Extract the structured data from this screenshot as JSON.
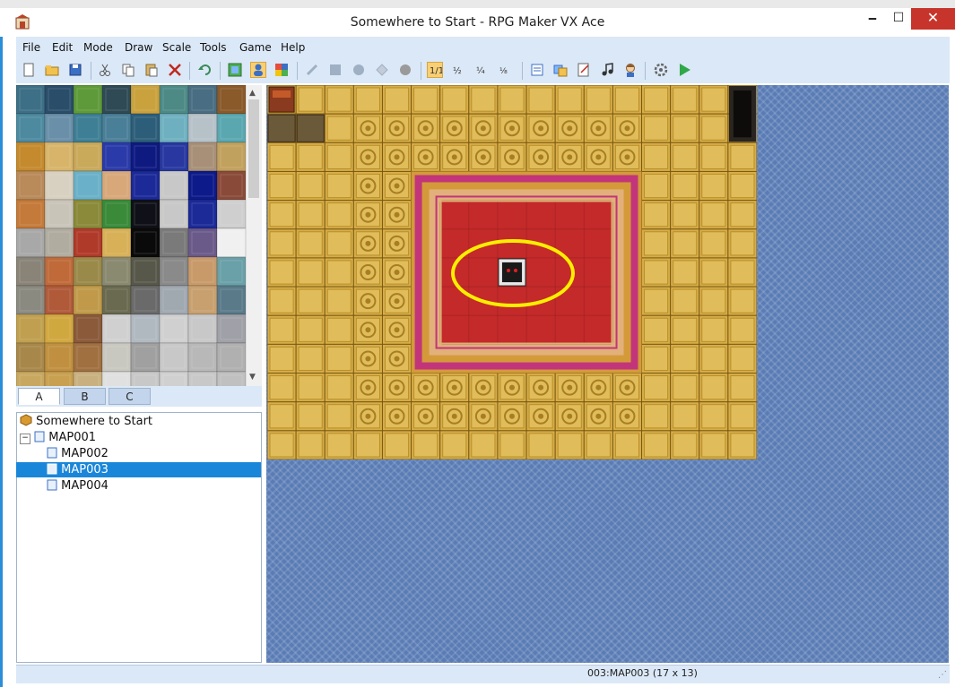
{
  "window": {
    "title": "Somewhere to Start - RPG Maker VX Ace",
    "controls": {
      "minimize": "🗕",
      "maximize": "☐",
      "close": "✕"
    }
  },
  "menu": [
    "File",
    "Edit",
    "Mode",
    "Draw",
    "Scale",
    "Tools",
    "Game",
    "Help"
  ],
  "toolbar": {
    "icons": [
      "new-project-icon",
      "open-project-icon",
      "save-project-icon",
      "cut-icon",
      "copy-icon",
      "paste-icon",
      "delete-icon",
      "undo-icon",
      "map-mode-icon",
      "event-mode-icon",
      "region-mode-icon",
      "pencil-icon",
      "rectangle-icon",
      "ellipse-icon",
      "flood-fill-icon",
      "shadow-pen-icon",
      "zoom-1-1-icon",
      "zoom-1-2-icon",
      "zoom-1-4-icon",
      "zoom-1-8-icon",
      "database-icon",
      "resource-manager-icon",
      "script-editor-icon",
      "sound-test-icon",
      "character-generator-icon",
      "options-icon",
      "playtest-icon"
    ],
    "active": [
      "event-mode-icon",
      "zoom-1-1-icon"
    ]
  },
  "tileset_tabs": [
    "A",
    "B",
    "C"
  ],
  "selected_tab": "A",
  "map_tree": {
    "project": "Somewhere to Start",
    "maps": [
      {
        "name": "MAP001",
        "level": 0,
        "selected": false
      },
      {
        "name": "MAP002",
        "level": 1,
        "selected": false
      },
      {
        "name": "MAP003",
        "level": 1,
        "selected": true
      },
      {
        "name": "MAP004",
        "level": 1,
        "selected": false
      }
    ]
  },
  "map": {
    "columns": 17,
    "rows": 13,
    "event_count": 1
  },
  "status": {
    "map_info": "003:MAP003 (17 x 13)"
  },
  "colors": {
    "accent": "#1a86d9",
    "menu_bg": "#dbe8f7",
    "floor": "#d8b24a",
    "carpet": "#c42a2a",
    "highlight_ring": "#ffee00",
    "map_bg": "#5a7cb5"
  }
}
